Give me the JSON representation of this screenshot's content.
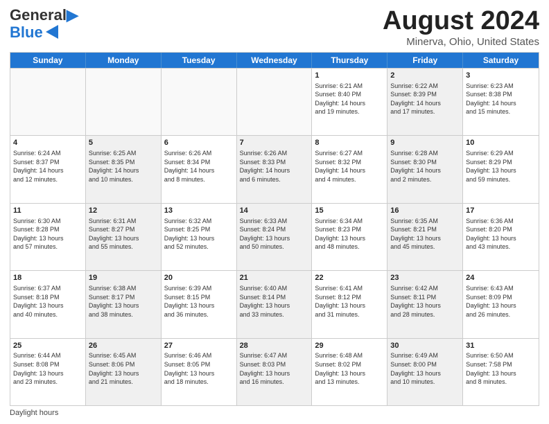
{
  "header": {
    "logo_line1": "General",
    "logo_line2": "Blue",
    "title": "August 2024",
    "subtitle": "Minerva, Ohio, United States"
  },
  "weekdays": [
    "Sunday",
    "Monday",
    "Tuesday",
    "Wednesday",
    "Thursday",
    "Friday",
    "Saturday"
  ],
  "rows": [
    [
      {
        "day": "",
        "info": "",
        "shaded": false,
        "empty": true
      },
      {
        "day": "",
        "info": "",
        "shaded": false,
        "empty": true
      },
      {
        "day": "",
        "info": "",
        "shaded": false,
        "empty": true
      },
      {
        "day": "",
        "info": "",
        "shaded": false,
        "empty": true
      },
      {
        "day": "1",
        "info": "Sunrise: 6:21 AM\nSunset: 8:40 PM\nDaylight: 14 hours\nand 19 minutes.",
        "shaded": false,
        "empty": false
      },
      {
        "day": "2",
        "info": "Sunrise: 6:22 AM\nSunset: 8:39 PM\nDaylight: 14 hours\nand 17 minutes.",
        "shaded": true,
        "empty": false
      },
      {
        "day": "3",
        "info": "Sunrise: 6:23 AM\nSunset: 8:38 PM\nDaylight: 14 hours\nand 15 minutes.",
        "shaded": false,
        "empty": false
      }
    ],
    [
      {
        "day": "4",
        "info": "Sunrise: 6:24 AM\nSunset: 8:37 PM\nDaylight: 14 hours\nand 12 minutes.",
        "shaded": false,
        "empty": false
      },
      {
        "day": "5",
        "info": "Sunrise: 6:25 AM\nSunset: 8:35 PM\nDaylight: 14 hours\nand 10 minutes.",
        "shaded": true,
        "empty": false
      },
      {
        "day": "6",
        "info": "Sunrise: 6:26 AM\nSunset: 8:34 PM\nDaylight: 14 hours\nand 8 minutes.",
        "shaded": false,
        "empty": false
      },
      {
        "day": "7",
        "info": "Sunrise: 6:26 AM\nSunset: 8:33 PM\nDaylight: 14 hours\nand 6 minutes.",
        "shaded": true,
        "empty": false
      },
      {
        "day": "8",
        "info": "Sunrise: 6:27 AM\nSunset: 8:32 PM\nDaylight: 14 hours\nand 4 minutes.",
        "shaded": false,
        "empty": false
      },
      {
        "day": "9",
        "info": "Sunrise: 6:28 AM\nSunset: 8:30 PM\nDaylight: 14 hours\nand 2 minutes.",
        "shaded": true,
        "empty": false
      },
      {
        "day": "10",
        "info": "Sunrise: 6:29 AM\nSunset: 8:29 PM\nDaylight: 13 hours\nand 59 minutes.",
        "shaded": false,
        "empty": false
      }
    ],
    [
      {
        "day": "11",
        "info": "Sunrise: 6:30 AM\nSunset: 8:28 PM\nDaylight: 13 hours\nand 57 minutes.",
        "shaded": false,
        "empty": false
      },
      {
        "day": "12",
        "info": "Sunrise: 6:31 AM\nSunset: 8:27 PM\nDaylight: 13 hours\nand 55 minutes.",
        "shaded": true,
        "empty": false
      },
      {
        "day": "13",
        "info": "Sunrise: 6:32 AM\nSunset: 8:25 PM\nDaylight: 13 hours\nand 52 minutes.",
        "shaded": false,
        "empty": false
      },
      {
        "day": "14",
        "info": "Sunrise: 6:33 AM\nSunset: 8:24 PM\nDaylight: 13 hours\nand 50 minutes.",
        "shaded": true,
        "empty": false
      },
      {
        "day": "15",
        "info": "Sunrise: 6:34 AM\nSunset: 8:23 PM\nDaylight: 13 hours\nand 48 minutes.",
        "shaded": false,
        "empty": false
      },
      {
        "day": "16",
        "info": "Sunrise: 6:35 AM\nSunset: 8:21 PM\nDaylight: 13 hours\nand 45 minutes.",
        "shaded": true,
        "empty": false
      },
      {
        "day": "17",
        "info": "Sunrise: 6:36 AM\nSunset: 8:20 PM\nDaylight: 13 hours\nand 43 minutes.",
        "shaded": false,
        "empty": false
      }
    ],
    [
      {
        "day": "18",
        "info": "Sunrise: 6:37 AM\nSunset: 8:18 PM\nDaylight: 13 hours\nand 40 minutes.",
        "shaded": false,
        "empty": false
      },
      {
        "day": "19",
        "info": "Sunrise: 6:38 AM\nSunset: 8:17 PM\nDaylight: 13 hours\nand 38 minutes.",
        "shaded": true,
        "empty": false
      },
      {
        "day": "20",
        "info": "Sunrise: 6:39 AM\nSunset: 8:15 PM\nDaylight: 13 hours\nand 36 minutes.",
        "shaded": false,
        "empty": false
      },
      {
        "day": "21",
        "info": "Sunrise: 6:40 AM\nSunset: 8:14 PM\nDaylight: 13 hours\nand 33 minutes.",
        "shaded": true,
        "empty": false
      },
      {
        "day": "22",
        "info": "Sunrise: 6:41 AM\nSunset: 8:12 PM\nDaylight: 13 hours\nand 31 minutes.",
        "shaded": false,
        "empty": false
      },
      {
        "day": "23",
        "info": "Sunrise: 6:42 AM\nSunset: 8:11 PM\nDaylight: 13 hours\nand 28 minutes.",
        "shaded": true,
        "empty": false
      },
      {
        "day": "24",
        "info": "Sunrise: 6:43 AM\nSunset: 8:09 PM\nDaylight: 13 hours\nand 26 minutes.",
        "shaded": false,
        "empty": false
      }
    ],
    [
      {
        "day": "25",
        "info": "Sunrise: 6:44 AM\nSunset: 8:08 PM\nDaylight: 13 hours\nand 23 minutes.",
        "shaded": false,
        "empty": false
      },
      {
        "day": "26",
        "info": "Sunrise: 6:45 AM\nSunset: 8:06 PM\nDaylight: 13 hours\nand 21 minutes.",
        "shaded": true,
        "empty": false
      },
      {
        "day": "27",
        "info": "Sunrise: 6:46 AM\nSunset: 8:05 PM\nDaylight: 13 hours\nand 18 minutes.",
        "shaded": false,
        "empty": false
      },
      {
        "day": "28",
        "info": "Sunrise: 6:47 AM\nSunset: 8:03 PM\nDaylight: 13 hours\nand 16 minutes.",
        "shaded": true,
        "empty": false
      },
      {
        "day": "29",
        "info": "Sunrise: 6:48 AM\nSunset: 8:02 PM\nDaylight: 13 hours\nand 13 minutes.",
        "shaded": false,
        "empty": false
      },
      {
        "day": "30",
        "info": "Sunrise: 6:49 AM\nSunset: 8:00 PM\nDaylight: 13 hours\nand 10 minutes.",
        "shaded": true,
        "empty": false
      },
      {
        "day": "31",
        "info": "Sunrise: 6:50 AM\nSunset: 7:58 PM\nDaylight: 13 hours\nand 8 minutes.",
        "shaded": false,
        "empty": false
      }
    ]
  ],
  "footer": {
    "daylight_label": "Daylight hours"
  }
}
